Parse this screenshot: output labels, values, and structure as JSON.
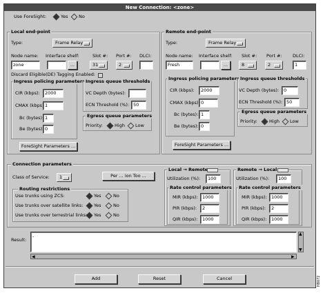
{
  "window": {
    "title": "New Connection: <zone>"
  },
  "foresight": {
    "label": "Use ForeSight:",
    "yes": "Yes",
    "no": "No"
  },
  "local": {
    "title": "Local end-point",
    "type_label": "Type:",
    "type_value": "Frame Relay",
    "node_label": "Node name:",
    "shelf_label": "Interface shelf:",
    "slot_label": "Slot #:",
    "port_label": "Port #:",
    "dlci_label": "DLCI:",
    "node_value": "zone",
    "shelf_value": "",
    "slot_value": "31",
    "port_value": "2",
    "dlci_value": "",
    "ellipsis": "...",
    "discard_label": "Discard Eligible(DE) Tagging Enabled:",
    "policing": {
      "title": "Ingress policing parameters",
      "cir_label": "CIR (kbps):",
      "cir_value": "2000",
      "cmax_label": "CMAX (kbps):",
      "cmax_value": "1",
      "bc_label": "Bc (bytes):",
      "bc_value": "1",
      "be_label": "Be (bytes):",
      "be_value": "0"
    },
    "queue": {
      "title": "Ingress queue thresholds",
      "vc_label": "VC Depth (bytes):",
      "vc_value": "",
      "ecn_label": "ECN Threshold (%):",
      "ecn_value": "50"
    },
    "eqp": {
      "title": "Egress queue parameters",
      "priority_label": "Priority:",
      "high": "High",
      "low": "Low"
    },
    "fs_button": "ForeSight Parameters ..."
  },
  "remote": {
    "title": "Remote end-point",
    "type_label": "Type:",
    "type_value": "Frame Relay",
    "node_label": "Node name:",
    "shelf_label": "Interface shelf:",
    "slot_label": "Slot #:",
    "port_label": "Port #:",
    "dlci_label": "DLCI:",
    "node_value": "Fresh",
    "shelf_value": "",
    "slot_value": "8",
    "port_value": "2",
    "dlci_value": "1",
    "ellipsis": "...",
    "policing": {
      "title": "Ingress policing parameters",
      "cir_label": "CIR (kbps):",
      "cir_value": "2000",
      "cmax_label": "CMAX (kbps):",
      "cmax_value": "0",
      "bc_label": "Bc (bytes):",
      "bc_value": "1",
      "be_label": "Be (bytes):",
      "be_value": "0"
    },
    "queue": {
      "title": "Ingress queue thresholds",
      "vc_label": "VC Depth (bytes):",
      "vc_value": "0",
      "ecn_label": "ECN Threshold (%):",
      "ecn_value": "50"
    },
    "eqp": {
      "title": "Egress queue parameters",
      "priority_label": "Priority:",
      "high": "High",
      "low": "Low"
    },
    "fs_button": "ForeSight Parameters ..."
  },
  "connection": {
    "title": "Connection parameters",
    "cos_label": "Class of Service:",
    "cos_value": "1",
    "pattern_button": "Per ... ion Too ...",
    "routing": {
      "title": "Routing restrictions",
      "zcs_label": "Use trunks using ZCS:",
      "sat_label": "Use trunks over satellite links:",
      "ter_label": "Use trunks over terrestrial links:",
      "yes": "Yes",
      "no": "No"
    },
    "l2r": {
      "title": "Local → Remote",
      "util_label": "Utilization (%):",
      "util_value": "100",
      "rate_title": "Rate control parameters",
      "mir_label": "MIR (kbps):",
      "mir_value": "1000",
      "pir_label": "PIR (kbps):",
      "pir_value": "2",
      "qir_label": "QIR (kbps):",
      "qir_value": "1000"
    },
    "r2l": {
      "title": "Remote → Local",
      "util_label": "Utilization (%):",
      "util_value": "100",
      "rate_title": "Rate control parameters",
      "mir_label": "MIR (kbps):",
      "mir_value": "1000",
      "pir_label": "PIR (kbps):",
      "pir_value": "2",
      "qir_label": "QIR (kbps):",
      "qir_value": "1000"
    }
  },
  "result": {
    "label": "Result:",
    "value": "-"
  },
  "buttons": {
    "add": "Add",
    "reset": "Reset",
    "cancel": "Cancel"
  },
  "figure_id": "H8072"
}
